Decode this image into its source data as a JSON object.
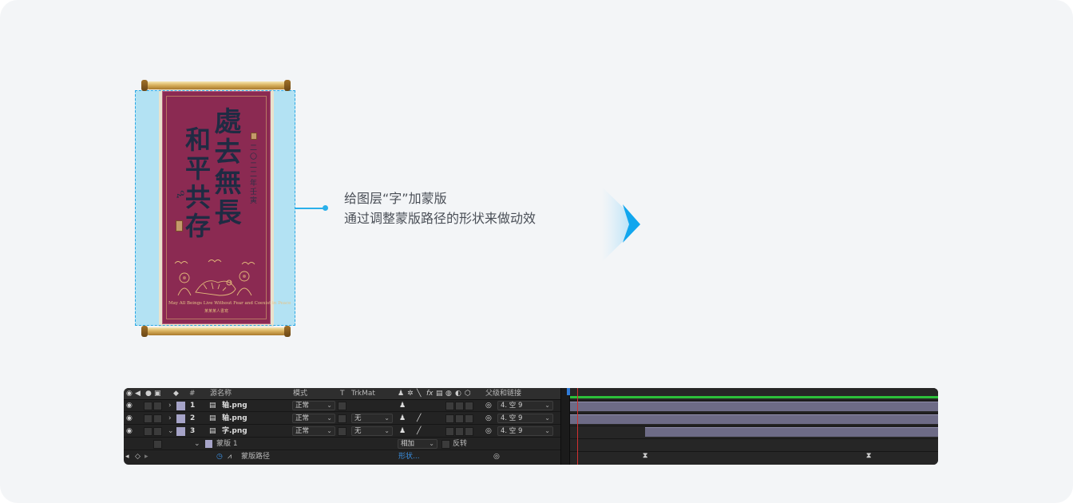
{
  "scroll": {
    "calligraphy_col1": "處去無長",
    "calligraphy_col2": "和平共存",
    "inscription": "二〇二二年壬寅",
    "caption_line1": "May All Beings Live Without Fear and Coexist in Peace",
    "caption_line2": "某某某人書寫"
  },
  "description": {
    "line1": "给图层“字”加蒙版",
    "line2": "通过调整蒙版路径的形状来做动效"
  },
  "colors": {
    "accent": "#2ab0ea",
    "layer_label": "#a6a4c8",
    "work_area": "#2cbf3a",
    "playhead": "#d23030"
  },
  "timeline": {
    "header": {
      "hash": "#",
      "source_name": "源名称",
      "mode": "模式",
      "t": "T",
      "trkmat": "TrkMat",
      "switch_fx": "fx",
      "parent": "父级和链接"
    },
    "layers": [
      {
        "num": "1",
        "name": "轴.png",
        "mode": "正常",
        "trkmat": "",
        "parent": "4. 空 9",
        "expanded": false
      },
      {
        "num": "2",
        "name": "轴.png",
        "mode": "正常",
        "trkmat": "无",
        "parent": "4. 空 9",
        "expanded": false
      },
      {
        "num": "3",
        "name": "字.png",
        "mode": "正常",
        "trkmat": "无",
        "parent": "4. 空 9",
        "expanded": true
      }
    ],
    "mask": {
      "name": "蒙版 1",
      "mode": "相加",
      "invert_label": "反转",
      "path_label": "蒙版路径",
      "path_value": "形状..."
    },
    "icons": {
      "visibility": "eye-icon",
      "audio": "speaker-icon",
      "solo": "solo-dot-icon",
      "lock": "lock-icon",
      "label": "tag-icon",
      "file": "file-icon",
      "stopwatch": "stopwatch-icon",
      "pickwhip": "pickwhip-icon",
      "keyframe": "keyframe-icon"
    }
  }
}
